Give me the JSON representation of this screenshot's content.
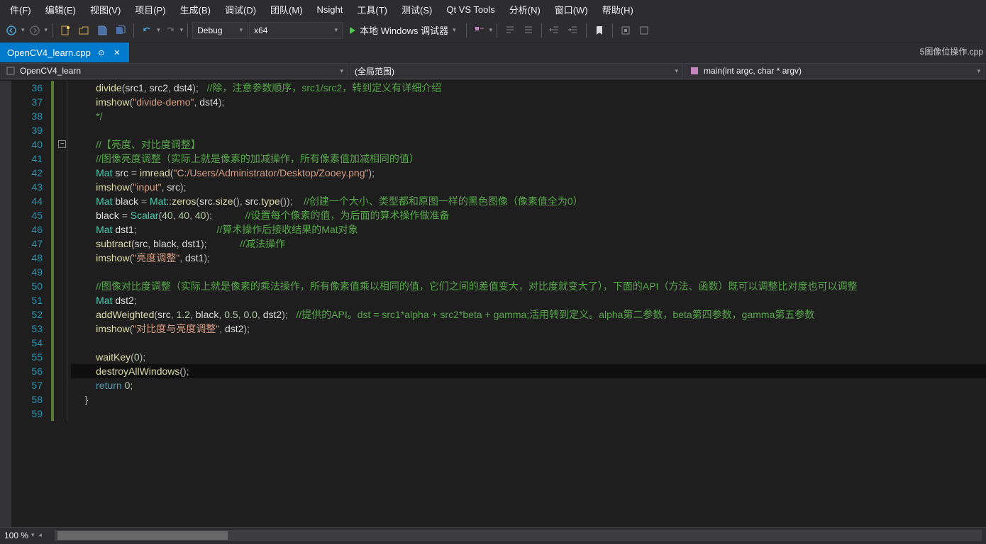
{
  "menu": [
    "件(F)",
    "编辑(E)",
    "视图(V)",
    "项目(P)",
    "生成(B)",
    "调试(D)",
    "团队(M)",
    "Nsight",
    "工具(T)",
    "测试(S)",
    "Qt VS Tools",
    "分析(N)",
    "窗口(W)",
    "帮助(H)"
  ],
  "toolbar": {
    "config": "Debug",
    "platform": "x64",
    "debugger": "本地 Windows 调试器"
  },
  "tab": {
    "name": "OpenCV4_learn.cpp",
    "extra": "5图像位操作.cpp"
  },
  "nav": {
    "scope1": "OpenCV4_learn",
    "scope2": "(全局范围)",
    "scope3": "main(int argc, char * argv)"
  },
  "lines": [
    {
      "n": 36,
      "seg": [
        [
          "",
          "        "
        ],
        [
          "fn",
          "divide"
        ],
        [
          "op",
          "("
        ],
        [
          "id",
          "src1"
        ],
        [
          "op",
          ", "
        ],
        [
          "id",
          "src2"
        ],
        [
          "op",
          ", "
        ],
        [
          "id",
          "dst4"
        ],
        [
          "op",
          ");   "
        ],
        [
          "cm",
          "//除，注意参数顺序，src1/src2，转到定义有详细介绍"
        ]
      ]
    },
    {
      "n": 37,
      "seg": [
        [
          "",
          "        "
        ],
        [
          "fn",
          "imshow"
        ],
        [
          "op",
          "("
        ],
        [
          "st",
          "\"divide-demo\""
        ],
        [
          "op",
          ", "
        ],
        [
          "id",
          "dst4"
        ],
        [
          "op",
          ");"
        ]
      ]
    },
    {
      "n": 38,
      "seg": [
        [
          "",
          "        "
        ],
        [
          "cm",
          "*/"
        ]
      ]
    },
    {
      "n": 39,
      "seg": [
        [
          "",
          ""
        ]
      ]
    },
    {
      "n": 40,
      "fold": true,
      "seg": [
        [
          "",
          "        "
        ],
        [
          "cm",
          "//【亮度、对比度调整】"
        ]
      ]
    },
    {
      "n": 41,
      "seg": [
        [
          "",
          "        "
        ],
        [
          "cm",
          "//图像亮度调整（实际上就是像素的加减操作，所有像素值加减相同的值）"
        ]
      ]
    },
    {
      "n": 42,
      "seg": [
        [
          "",
          "        "
        ],
        [
          "tp",
          "Mat"
        ],
        [
          "",
          " "
        ],
        [
          "id",
          "src"
        ],
        [
          "",
          " "
        ],
        [
          "op",
          "="
        ],
        [
          "",
          " "
        ],
        [
          "fn",
          "imread"
        ],
        [
          "op",
          "("
        ],
        [
          "st",
          "\"C:/Users/Administrator/Desktop/Zooey.png\""
        ],
        [
          "op",
          ");"
        ]
      ]
    },
    {
      "n": 43,
      "seg": [
        [
          "",
          "        "
        ],
        [
          "fn",
          "imshow"
        ],
        [
          "op",
          "("
        ],
        [
          "st",
          "\"input\""
        ],
        [
          "op",
          ", "
        ],
        [
          "id",
          "src"
        ],
        [
          "op",
          ");"
        ]
      ]
    },
    {
      "n": 44,
      "seg": [
        [
          "",
          "        "
        ],
        [
          "tp",
          "Mat"
        ],
        [
          "",
          " "
        ],
        [
          "id",
          "black"
        ],
        [
          "",
          " "
        ],
        [
          "op",
          "="
        ],
        [
          "",
          " "
        ],
        [
          "tp",
          "Mat"
        ],
        [
          "op",
          "::"
        ],
        [
          "fn",
          "zeros"
        ],
        [
          "op",
          "("
        ],
        [
          "id",
          "src"
        ],
        [
          "op",
          "."
        ],
        [
          "fn",
          "size"
        ],
        [
          "op",
          "(), "
        ],
        [
          "id",
          "src"
        ],
        [
          "op",
          "."
        ],
        [
          "fn",
          "type"
        ],
        [
          "op",
          "());    "
        ],
        [
          "cm",
          "//创建一个大小、类型都和原图一样的黑色图像（像素值全为0）"
        ]
      ]
    },
    {
      "n": 45,
      "seg": [
        [
          "",
          "        "
        ],
        [
          "id",
          "black"
        ],
        [
          "",
          " "
        ],
        [
          "op",
          "="
        ],
        [
          "",
          " "
        ],
        [
          "tp",
          "Scalar"
        ],
        [
          "op",
          "("
        ],
        [
          "nm",
          "40"
        ],
        [
          "op",
          ", "
        ],
        [
          "nm",
          "40"
        ],
        [
          "op",
          ", "
        ],
        [
          "nm",
          "40"
        ],
        [
          "op",
          ");            "
        ],
        [
          "cm",
          "//设置每个像素的值，为后面的算术操作做准备"
        ]
      ]
    },
    {
      "n": 46,
      "seg": [
        [
          "",
          "        "
        ],
        [
          "tp",
          "Mat"
        ],
        [
          "",
          " "
        ],
        [
          "id",
          "dst1"
        ],
        [
          "op",
          ";                             "
        ],
        [
          "cm",
          "//算术操作后接收结果的Mat对象"
        ]
      ]
    },
    {
      "n": 47,
      "seg": [
        [
          "",
          "        "
        ],
        [
          "fn",
          "subtract"
        ],
        [
          "op",
          "("
        ],
        [
          "id",
          "src"
        ],
        [
          "op",
          ", "
        ],
        [
          "id",
          "black"
        ],
        [
          "op",
          ", "
        ],
        [
          "id",
          "dst1"
        ],
        [
          "op",
          ");            "
        ],
        [
          "cm",
          "//减法操作"
        ]
      ]
    },
    {
      "n": 48,
      "seg": [
        [
          "",
          "        "
        ],
        [
          "fn",
          "imshow"
        ],
        [
          "op",
          "("
        ],
        [
          "st",
          "\"亮度调整\""
        ],
        [
          "op",
          ", "
        ],
        [
          "id",
          "dst1"
        ],
        [
          "op",
          ");"
        ]
      ]
    },
    {
      "n": 49,
      "seg": [
        [
          "",
          ""
        ]
      ]
    },
    {
      "n": 50,
      "seg": [
        [
          "",
          "        "
        ],
        [
          "cm",
          "//图像对比度调整（实际上就是像素的乘法操作，所有像素值乘以相同的值，它们之间的差值变大，对比度就变大了），下面的API（方法、函数）既可以调整比对度也可以调整"
        ]
      ]
    },
    {
      "n": 51,
      "seg": [
        [
          "",
          "        "
        ],
        [
          "tp",
          "Mat"
        ],
        [
          "",
          " "
        ],
        [
          "id",
          "dst2"
        ],
        [
          "op",
          ";"
        ]
      ]
    },
    {
      "n": 52,
      "seg": [
        [
          "",
          "        "
        ],
        [
          "fn",
          "addWeighted"
        ],
        [
          "op",
          "("
        ],
        [
          "id",
          "src"
        ],
        [
          "op",
          ", "
        ],
        [
          "nm",
          "1.2"
        ],
        [
          "op",
          ", "
        ],
        [
          "id",
          "black"
        ],
        [
          "op",
          ", "
        ],
        [
          "nm",
          "0.5"
        ],
        [
          "op",
          ", "
        ],
        [
          "nm",
          "0.0"
        ],
        [
          "op",
          ", "
        ],
        [
          "id",
          "dst2"
        ],
        [
          "op",
          ");   "
        ],
        [
          "cm",
          "//提供的API。dst = src1*alpha + src2*beta + gamma;活用转到定义。alpha第二参数，beta第四参数，gamma第五参数"
        ]
      ]
    },
    {
      "n": 53,
      "seg": [
        [
          "",
          "        "
        ],
        [
          "fn",
          "imshow"
        ],
        [
          "op",
          "("
        ],
        [
          "st",
          "\"对比度与亮度调整\""
        ],
        [
          "op",
          ", "
        ],
        [
          "id",
          "dst2"
        ],
        [
          "op",
          ");"
        ]
      ]
    },
    {
      "n": 54,
      "seg": [
        [
          "",
          ""
        ]
      ]
    },
    {
      "n": 55,
      "seg": [
        [
          "",
          "        "
        ],
        [
          "fn",
          "waitKey"
        ],
        [
          "op",
          "("
        ],
        [
          "nm",
          "0"
        ],
        [
          "op",
          ");"
        ]
      ]
    },
    {
      "n": 56,
      "hl": true,
      "seg": [
        [
          "",
          "        "
        ],
        [
          "fn",
          "destroyAllWindows"
        ],
        [
          "op",
          "();"
        ]
      ]
    },
    {
      "n": 57,
      "seg": [
        [
          "",
          "        "
        ],
        [
          "kw",
          "return"
        ],
        [
          "",
          " "
        ],
        [
          "nm",
          "0"
        ],
        [
          "op",
          ";"
        ]
      ]
    },
    {
      "n": 58,
      "seg": [
        [
          "",
          "    "
        ],
        [
          "op",
          "}"
        ]
      ]
    },
    {
      "n": 59,
      "seg": [
        [
          "",
          ""
        ]
      ]
    }
  ],
  "status": {
    "zoom": "100 %"
  }
}
